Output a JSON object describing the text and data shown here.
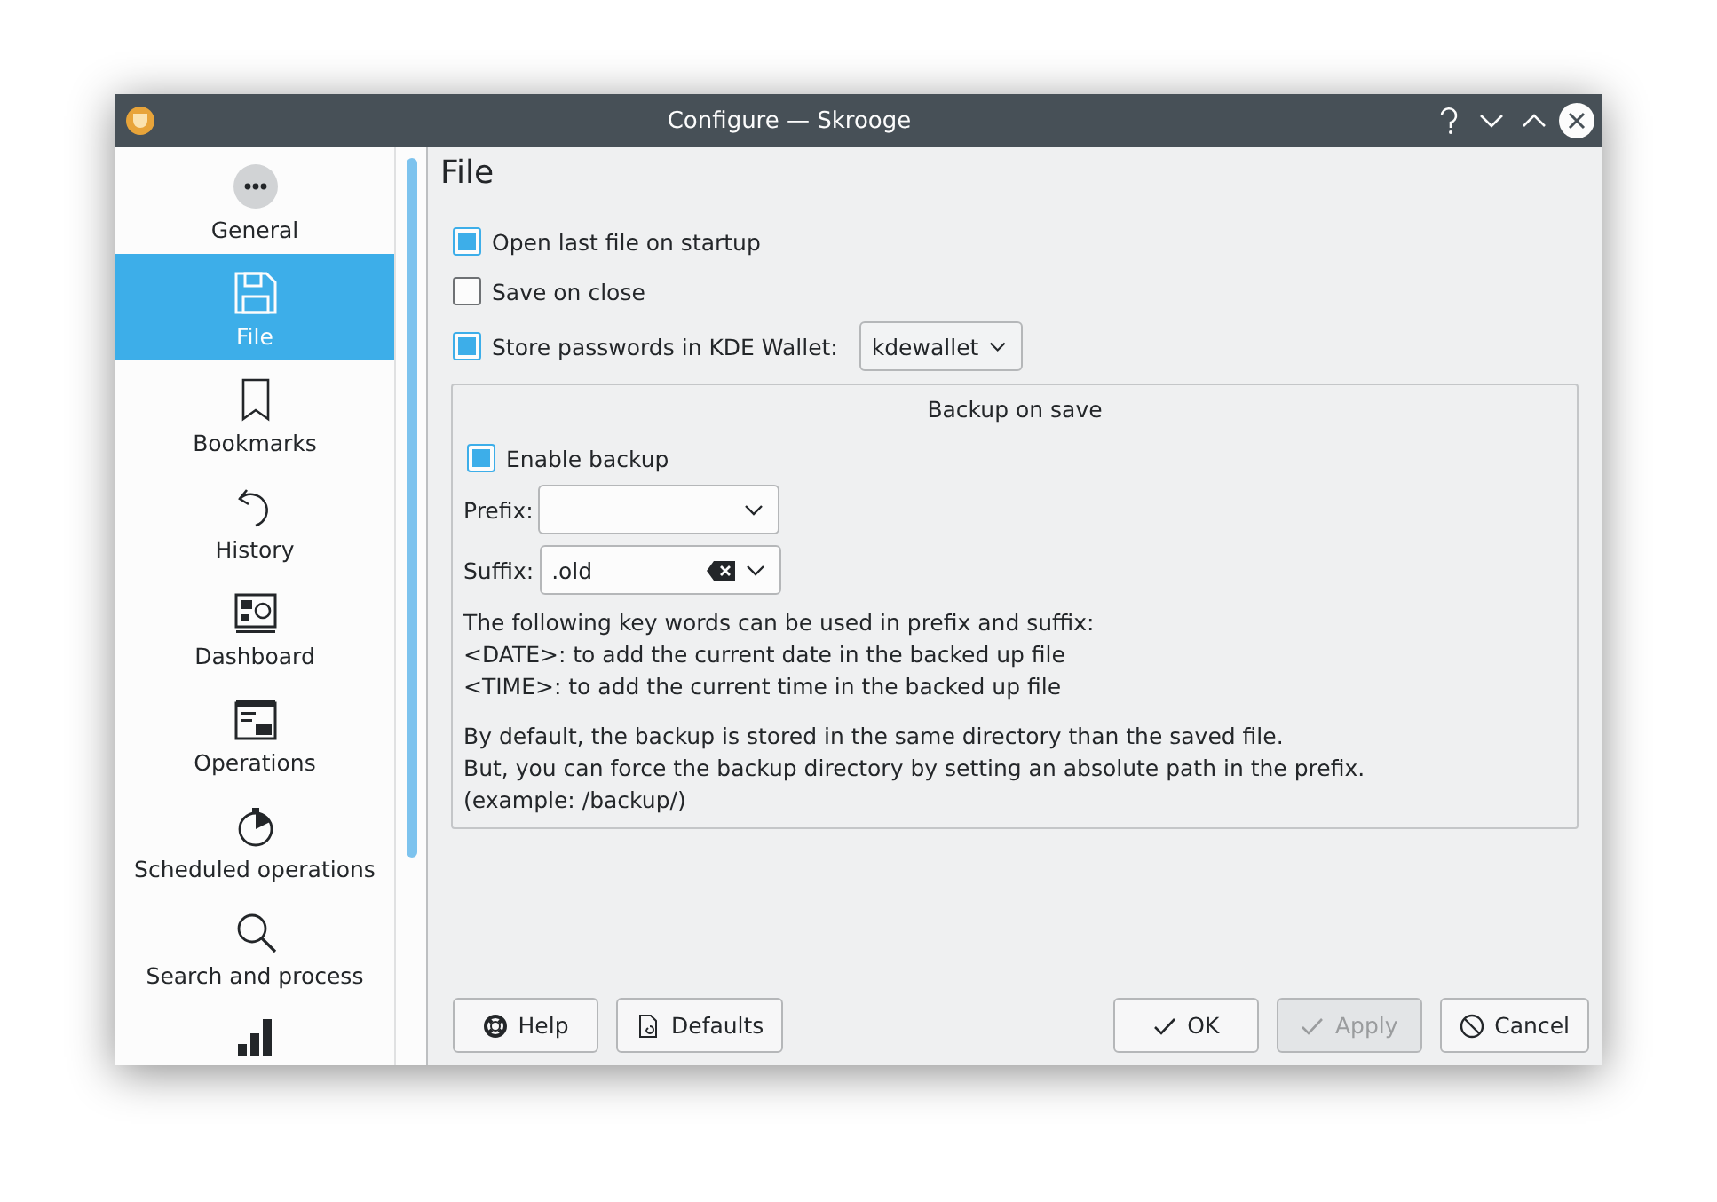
{
  "window": {
    "title": "Configure — Skrooge"
  },
  "sidebar": {
    "items": [
      {
        "label": "General",
        "selected": false
      },
      {
        "label": "File",
        "selected": true
      },
      {
        "label": "Bookmarks",
        "selected": false
      },
      {
        "label": "History",
        "selected": false
      },
      {
        "label": "Dashboard",
        "selected": false
      },
      {
        "label": "Operations",
        "selected": false
      },
      {
        "label": "Scheduled operations",
        "selected": false
      },
      {
        "label": "Search and process",
        "selected": false
      },
      {
        "selected": false
      }
    ]
  },
  "page": {
    "title": "File",
    "options": [
      {
        "label": "Open last file on startup",
        "checked": true
      },
      {
        "label": "Save on close",
        "checked": false
      },
      {
        "label": "Store passwords in KDE Wallet:",
        "checked": true,
        "combo": "kdewallet"
      }
    ],
    "backup": {
      "title": "Backup on save",
      "enable": {
        "label": "Enable backup",
        "checked": true
      },
      "prefix": {
        "label": "Prefix:"
      },
      "suffix": {
        "label": "Suffix:",
        "value": ".old"
      },
      "lines": [
        "The following key words can be used in prefix and suffix:",
        "<DATE>: to add the current date in the backed up file",
        "<TIME>: to add the current time in the backed up file"
      ],
      "notes": [
        "By default, the backup is stored in the same directory than the saved file.",
        "But, you can force the backup directory by setting an absolute path in the prefix.",
        "(example: /backup/)"
      ]
    }
  },
  "buttons": [
    {
      "label": "Help",
      "kind": "help",
      "disabled": false
    },
    {
      "label": "Defaults",
      "kind": "defaults",
      "disabled": false
    },
    {
      "label": "OK",
      "kind": "ok",
      "disabled": false
    },
    {
      "label": "Apply",
      "kind": "apply",
      "disabled": true
    },
    {
      "label": "Cancel",
      "kind": "cancel",
      "disabled": false
    }
  ]
}
